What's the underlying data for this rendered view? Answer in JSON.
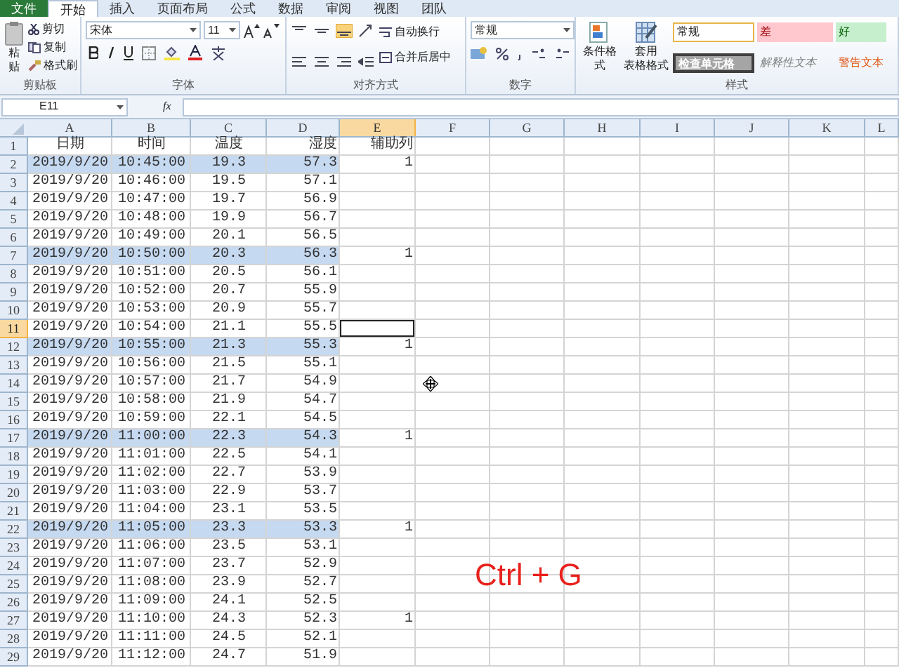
{
  "tabs": [
    {
      "label": "文件",
      "kind": "file",
      "selected": false
    },
    {
      "label": "开始",
      "kind": "tab",
      "selected": true
    },
    {
      "label": "插入",
      "kind": "tab",
      "selected": false
    },
    {
      "label": "页面布局",
      "kind": "tab",
      "selected": false
    },
    {
      "label": "公式",
      "kind": "tab",
      "selected": false
    },
    {
      "label": "数据",
      "kind": "tab",
      "selected": false
    },
    {
      "label": "审阅",
      "kind": "tab",
      "selected": false
    },
    {
      "label": "视图",
      "kind": "tab",
      "selected": false
    },
    {
      "label": "团队",
      "kind": "tab",
      "selected": false
    }
  ],
  "ribbon": {
    "clipboard": {
      "paste": "粘贴",
      "cut": "剪切",
      "copy": "复制",
      "format_painter": "格式刷",
      "label": "剪贴板"
    },
    "font": {
      "font_name": "宋体",
      "font_size": "11",
      "label": "字体"
    },
    "alignment": {
      "wrap_text": "自动换行",
      "merge_center": "合并后居中",
      "label": "对齐方式"
    },
    "number": {
      "format": "常规",
      "label": "数字"
    },
    "styles": {
      "conditional_formatting": "条件格式",
      "format_as_table": [
        "套用",
        "表格格式"
      ],
      "label": "样式",
      "cell_styles": [
        {
          "label": "常规",
          "kind": "normal"
        },
        {
          "label": "差",
          "kind": "bad"
        },
        {
          "label": "好",
          "kind": "good"
        },
        {
          "label": "检查单元格",
          "kind": "check"
        },
        {
          "label": "解释性文本",
          "kind": "explanatory"
        },
        {
          "label": "警告文本",
          "kind": "warning"
        }
      ]
    }
  },
  "formula_bar": {
    "name_box": "E11",
    "fx": "fx"
  },
  "sheet": {
    "columns": [
      {
        "label": "A",
        "selected": false
      },
      {
        "label": "B",
        "selected": false
      },
      {
        "label": "C",
        "selected": false
      },
      {
        "label": "D",
        "selected": false
      },
      {
        "label": "E",
        "selected": true
      },
      {
        "label": "F",
        "selected": false
      },
      {
        "label": "G",
        "selected": false
      },
      {
        "label": "H",
        "selected": false
      },
      {
        "label": "I",
        "selected": false
      },
      {
        "label": "J",
        "selected": false
      },
      {
        "label": "K",
        "selected": false
      },
      {
        "label": "L",
        "selected": false
      }
    ],
    "rows": [
      {
        "number": "1",
        "highlighted": false,
        "selected": false,
        "cells": [
          "日期",
          "时间",
          "温度",
          "湿度",
          "辅助列"
        ]
      },
      {
        "number": "2",
        "highlighted": true,
        "selected": false,
        "cells": [
          "2019/9/20",
          "10:45:00",
          "19.3",
          "57.3",
          "1"
        ]
      },
      {
        "number": "3",
        "highlighted": false,
        "selected": false,
        "cells": [
          "2019/9/20",
          "10:46:00",
          "19.5",
          "57.1",
          ""
        ]
      },
      {
        "number": "4",
        "highlighted": false,
        "selected": false,
        "cells": [
          "2019/9/20",
          "10:47:00",
          "19.7",
          "56.9",
          ""
        ]
      },
      {
        "number": "5",
        "highlighted": false,
        "selected": false,
        "cells": [
          "2019/9/20",
          "10:48:00",
          "19.9",
          "56.7",
          ""
        ]
      },
      {
        "number": "6",
        "highlighted": false,
        "selected": false,
        "cells": [
          "2019/9/20",
          "10:49:00",
          "20.1",
          "56.5",
          ""
        ]
      },
      {
        "number": "7",
        "highlighted": true,
        "selected": false,
        "cells": [
          "2019/9/20",
          "10:50:00",
          "20.3",
          "56.3",
          "1"
        ]
      },
      {
        "number": "8",
        "highlighted": false,
        "selected": false,
        "cells": [
          "2019/9/20",
          "10:51:00",
          "20.5",
          "56.1",
          ""
        ]
      },
      {
        "number": "9",
        "highlighted": false,
        "selected": false,
        "cells": [
          "2019/9/20",
          "10:52:00",
          "20.7",
          "55.9",
          ""
        ]
      },
      {
        "number": "10",
        "highlighted": false,
        "selected": false,
        "cells": [
          "2019/9/20",
          "10:53:00",
          "20.9",
          "55.7",
          ""
        ]
      },
      {
        "number": "11",
        "highlighted": false,
        "selected": true,
        "cells": [
          "2019/9/20",
          "10:54:00",
          "21.1",
          "55.5",
          ""
        ]
      },
      {
        "number": "12",
        "highlighted": true,
        "selected": false,
        "cells": [
          "2019/9/20",
          "10:55:00",
          "21.3",
          "55.3",
          "1"
        ]
      },
      {
        "number": "13",
        "highlighted": false,
        "selected": false,
        "cells": [
          "2019/9/20",
          "10:56:00",
          "21.5",
          "55.1",
          ""
        ]
      },
      {
        "number": "14",
        "highlighted": false,
        "selected": false,
        "cells": [
          "2019/9/20",
          "10:57:00",
          "21.7",
          "54.9",
          ""
        ]
      },
      {
        "number": "15",
        "highlighted": false,
        "selected": false,
        "cells": [
          "2019/9/20",
          "10:58:00",
          "21.9",
          "54.7",
          ""
        ]
      },
      {
        "number": "16",
        "highlighted": false,
        "selected": false,
        "cells": [
          "2019/9/20",
          "10:59:00",
          "22.1",
          "54.5",
          ""
        ]
      },
      {
        "number": "17",
        "highlighted": true,
        "selected": false,
        "cells": [
          "2019/9/20",
          "11:00:00",
          "22.3",
          "54.3",
          "1"
        ]
      },
      {
        "number": "18",
        "highlighted": false,
        "selected": false,
        "cells": [
          "2019/9/20",
          "11:01:00",
          "22.5",
          "54.1",
          ""
        ]
      },
      {
        "number": "19",
        "highlighted": false,
        "selected": false,
        "cells": [
          "2019/9/20",
          "11:02:00",
          "22.7",
          "53.9",
          ""
        ]
      },
      {
        "number": "20",
        "highlighted": false,
        "selected": false,
        "cells": [
          "2019/9/20",
          "11:03:00",
          "22.9",
          "53.7",
          ""
        ]
      },
      {
        "number": "21",
        "highlighted": false,
        "selected": false,
        "cells": [
          "2019/9/20",
          "11:04:00",
          "23.1",
          "53.5",
          ""
        ]
      },
      {
        "number": "22",
        "highlighted": true,
        "selected": false,
        "cells": [
          "2019/9/20",
          "11:05:00",
          "23.3",
          "53.3",
          "1"
        ]
      },
      {
        "number": "23",
        "highlighted": false,
        "selected": false,
        "cells": [
          "2019/9/20",
          "11:06:00",
          "23.5",
          "53.1",
          ""
        ]
      },
      {
        "number": "24",
        "highlighted": false,
        "selected": false,
        "cells": [
          "2019/9/20",
          "11:07:00",
          "23.7",
          "52.9",
          ""
        ]
      },
      {
        "number": "25",
        "highlighted": false,
        "selected": false,
        "cells": [
          "2019/9/20",
          "11:08:00",
          "23.9",
          "52.7",
          ""
        ]
      },
      {
        "number": "26",
        "highlighted": false,
        "selected": false,
        "cells": [
          "2019/9/20",
          "11:09:00",
          "24.1",
          "52.5",
          ""
        ]
      },
      {
        "number": "27",
        "highlighted": false,
        "selected": false,
        "cells": [
          "2019/9/20",
          "11:10:00",
          "24.3",
          "52.3",
          "1"
        ]
      },
      {
        "number": "28",
        "highlighted": false,
        "selected": false,
        "cells": [
          "2019/9/20",
          "11:11:00",
          "24.5",
          "52.1",
          ""
        ]
      },
      {
        "number": "29",
        "highlighted": false,
        "selected": false,
        "cells": [
          "2019/9/20",
          "11:12:00",
          "24.7",
          "51.9",
          ""
        ]
      }
    ]
  },
  "overlay_caption": "Ctrl + G"
}
